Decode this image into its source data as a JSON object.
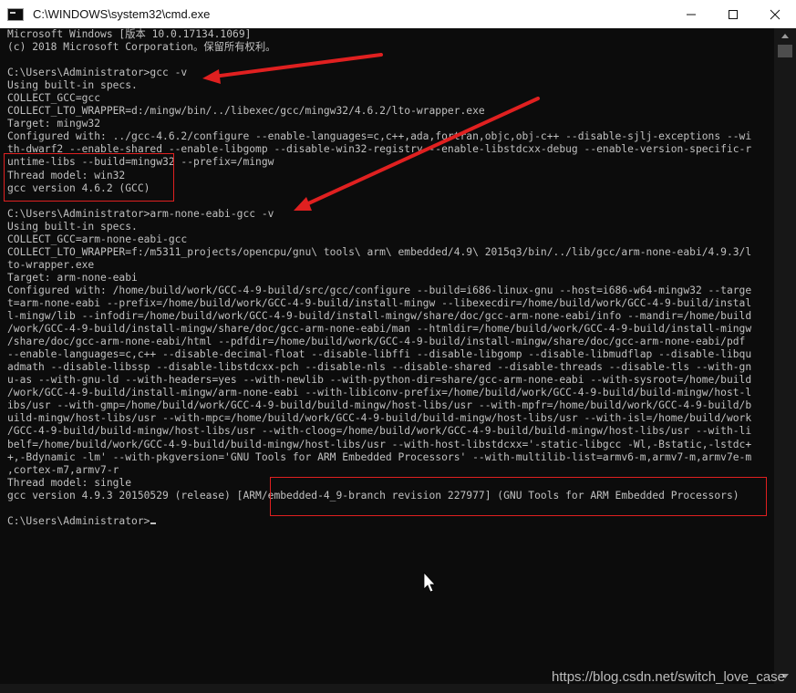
{
  "window": {
    "title": "C:\\WINDOWS\\system32\\cmd.exe",
    "minimize_icon": "minimize-icon",
    "maximize_icon": "maximize-icon",
    "close_icon": "close-icon"
  },
  "console": {
    "lines": [
      "Microsoft Windows [版本 10.0.17134.1069]",
      "(c) 2018 Microsoft Corporation。保留所有权利。",
      "",
      "C:\\Users\\Administrator>gcc -v",
      "Using built-in specs.",
      "COLLECT_GCC=gcc",
      "COLLECT_LTO_WRAPPER=d:/mingw/bin/../libexec/gcc/mingw32/4.6.2/lto-wrapper.exe",
      "Target: mingw32",
      "Configured with: ../gcc-4.6.2/configure --enable-languages=c,c++,ada,fortran,objc,obj-c++ --disable-sjlj-exceptions --wi",
      "th-dwarf2 --enable-shared --enable-libgomp --disable-win32-registry --enable-libstdcxx-debug --enable-version-specific-r",
      "untime-libs --build=mingw32 --prefix=/mingw",
      "Thread model: win32",
      "gcc version 4.6.2 (GCC)",
      "",
      "C:\\Users\\Administrator>arm-none-eabi-gcc -v",
      "Using built-in specs.",
      "COLLECT_GCC=arm-none-eabi-gcc",
      "COLLECT_LTO_WRAPPER=f:/m5311_projects/opencpu/gnu\\ tools\\ arm\\ embedded/4.9\\ 2015q3/bin/../lib/gcc/arm-none-eabi/4.9.3/l",
      "to-wrapper.exe",
      "Target: arm-none-eabi",
      "Configured with: /home/build/work/GCC-4-9-build/src/gcc/configure --build=i686-linux-gnu --host=i686-w64-mingw32 --targe",
      "t=arm-none-eabi --prefix=/home/build/work/GCC-4-9-build/install-mingw --libexecdir=/home/build/work/GCC-4-9-build/instal",
      "l-mingw/lib --infodir=/home/build/work/GCC-4-9-build/install-mingw/share/doc/gcc-arm-none-eabi/info --mandir=/home/build",
      "/work/GCC-4-9-build/install-mingw/share/doc/gcc-arm-none-eabi/man --htmldir=/home/build/work/GCC-4-9-build/install-mingw",
      "/share/doc/gcc-arm-none-eabi/html --pdfdir=/home/build/work/GCC-4-9-build/install-mingw/share/doc/gcc-arm-none-eabi/pdf",
      "--enable-languages=c,c++ --disable-decimal-float --disable-libffi --disable-libgomp --disable-libmudflap --disable-libqu",
      "admath --disable-libssp --disable-libstdcxx-pch --disable-nls --disable-shared --disable-threads --disable-tls --with-gn",
      "u-as --with-gnu-ld --with-headers=yes --with-newlib --with-python-dir=share/gcc-arm-none-eabi --with-sysroot=/home/build",
      "/work/GCC-4-9-build/install-mingw/arm-none-eabi --with-libiconv-prefix=/home/build/work/GCC-4-9-build/build-mingw/host-l",
      "ibs/usr --with-gmp=/home/build/work/GCC-4-9-build/build-mingw/host-libs/usr --with-mpfr=/home/build/work/GCC-4-9-build/b",
      "uild-mingw/host-libs/usr --with-mpc=/home/build/work/GCC-4-9-build/build-mingw/host-libs/usr --with-isl=/home/build/work",
      "/GCC-4-9-build/build-mingw/host-libs/usr --with-cloog=/home/build/work/GCC-4-9-build/build-mingw/host-libs/usr --with-li",
      "belf=/home/build/work/GCC-4-9-build/build-mingw/host-libs/usr --with-host-libstdcxx='-static-libgcc -Wl,-Bstatic,-lstdc+",
      "+,-Bdynamic -lm' --with-pkgversion='GNU Tools for ARM Embedded Processors' --with-multilib-list=armv6-m,armv7-m,armv7e-m",
      ",cortex-m7,armv7-r",
      "Thread model: single",
      "gcc version 4.9.3 20150529 (release) [ARM/embedded-4_9-branch revision 227977] (GNU Tools for ARM Embedded Processors)",
      "",
      "C:\\Users\\Administrator>"
    ]
  },
  "watermark": "https://blog.csdn.net/switch_love_case",
  "colors": {
    "background": "#0c0c0c",
    "text": "#c0c0c0",
    "annotation": "#e02020"
  }
}
